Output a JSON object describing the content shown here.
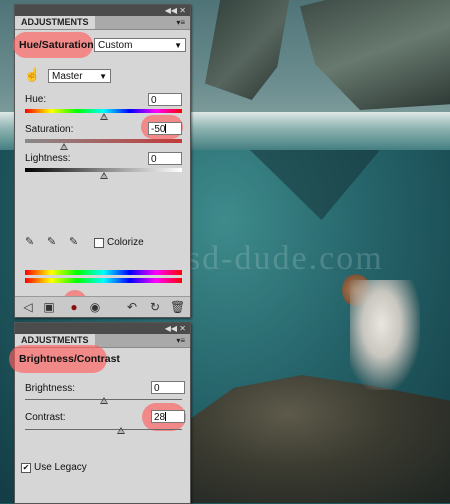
{
  "background": {
    "watermark": "www.psd-dude.com"
  },
  "hue_saturation_panel": {
    "header": "ADJUSTMENTS",
    "preset_label": "Hue/Saturation",
    "preset_value": "Custom",
    "hand_icon": "targeted-adjustment-hand-icon",
    "channel": "Master",
    "hue": {
      "label": "Hue:",
      "value": "0",
      "level": 0.5
    },
    "saturation": {
      "label": "Saturation:",
      "value": "-50",
      "level": 0.25
    },
    "lightness": {
      "label": "Lightness:",
      "value": "0",
      "level": 0.5
    },
    "colorize_label": "Colorize",
    "colorize_checked": false,
    "highlight_color": "#ff6060"
  },
  "brightness_contrast_panel": {
    "header": "ADJUSTMENTS",
    "preset_label": "Brightness/Contrast",
    "brightness": {
      "label": "Brightness:",
      "value": "0",
      "level": 0.5
    },
    "contrast": {
      "label": "Contrast:",
      "value": "28",
      "level": 0.61
    },
    "legacy_label": "Use Legacy",
    "legacy_checked": true
  }
}
